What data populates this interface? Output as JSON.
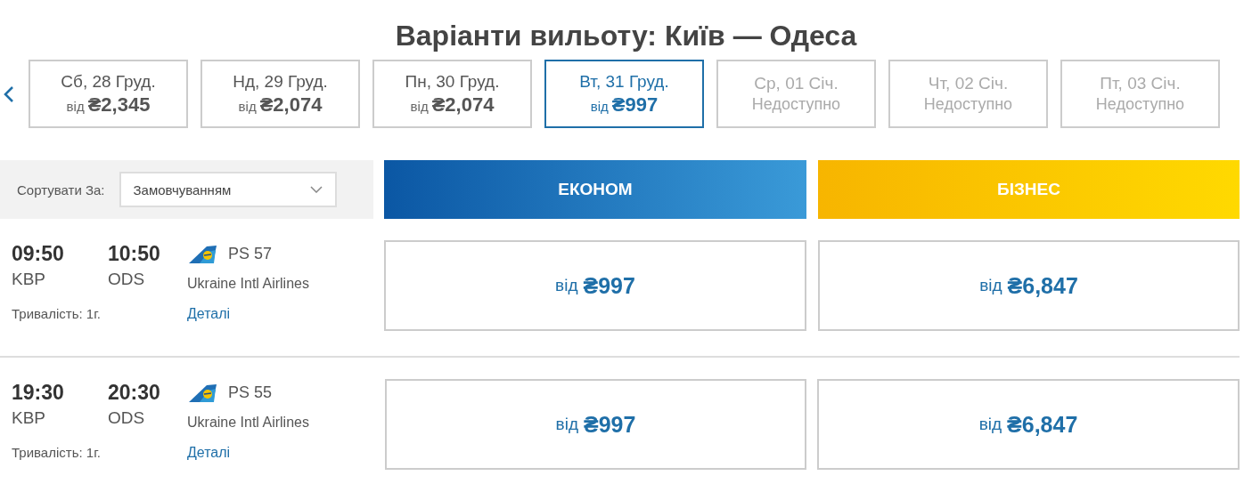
{
  "title": "Варіанти вильоту: Київ — Одеса",
  "dates": [
    {
      "day": "Сб, 28 Груд.",
      "prefix": "від",
      "price": "₴2,345",
      "available": true,
      "selected": false
    },
    {
      "day": "Нд, 29 Груд.",
      "prefix": "від",
      "price": "₴2,074",
      "available": true,
      "selected": false
    },
    {
      "day": "Пн, 30 Груд.",
      "prefix": "від",
      "price": "₴2,074",
      "available": true,
      "selected": false
    },
    {
      "day": "Вт, 31 Груд.",
      "prefix": "від",
      "price": "₴997",
      "available": true,
      "selected": true
    },
    {
      "day": "Ср, 01 Січ.",
      "status": "Недоступно",
      "available": false,
      "selected": false
    },
    {
      "day": "Чт, 02 Січ.",
      "status": "Недоступно",
      "available": false,
      "selected": false
    },
    {
      "day": "Пт, 03 Січ.",
      "status": "Недоступно",
      "available": false,
      "selected": false
    }
  ],
  "sort": {
    "label": "Сортувати За:",
    "value": "Замовчуванням"
  },
  "cabins": [
    {
      "label": "ЕКОНОМ",
      "kind": "economy"
    },
    {
      "label": "БІЗНЕС",
      "kind": "business"
    }
  ],
  "flights": [
    {
      "depart_time": "09:50",
      "depart_airport": "KBP",
      "arrive_time": "10:50",
      "arrive_airport": "ODS",
      "flight_number": "PS 57",
      "airline": "Ukraine Intl Airlines",
      "duration": "Тривалість: 1г.",
      "details_link": "Деталі",
      "fares": [
        {
          "prefix": "від",
          "price": "₴997"
        },
        {
          "prefix": "від",
          "price": "₴6,847"
        }
      ]
    },
    {
      "depart_time": "19:30",
      "depart_airport": "KBP",
      "arrive_time": "20:30",
      "arrive_airport": "ODS",
      "flight_number": "PS 55",
      "airline": "Ukraine Intl Airlines",
      "duration": "Тривалість: 1г.",
      "details_link": "Деталі",
      "fares": [
        {
          "prefix": "від",
          "price": "₴997"
        },
        {
          "prefix": "від",
          "price": "₴6,847"
        }
      ]
    }
  ]
}
